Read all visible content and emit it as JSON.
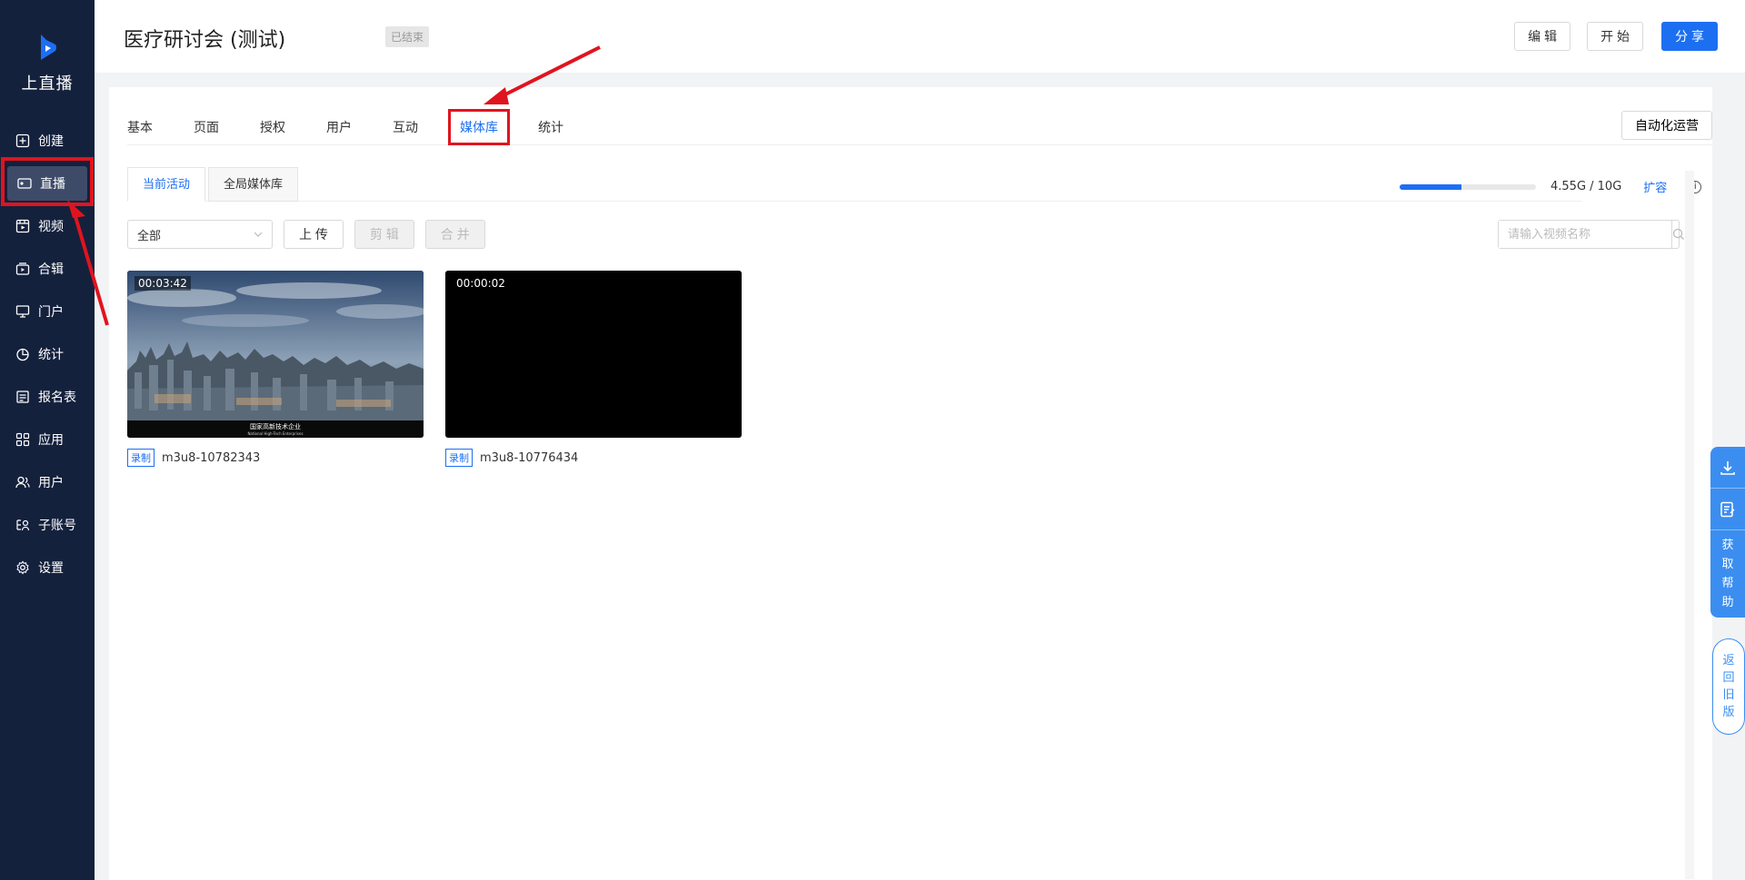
{
  "sidebar": {
    "brand": "上直播",
    "items": [
      {
        "label": "创建",
        "icon": "plus-square-icon"
      },
      {
        "label": "直播",
        "icon": "video-camera-icon"
      },
      {
        "label": "视频",
        "icon": "film-icon"
      },
      {
        "label": "合辑",
        "icon": "collection-icon"
      },
      {
        "label": "门户",
        "icon": "monitor-icon"
      },
      {
        "label": "统计",
        "icon": "pie-chart-icon"
      },
      {
        "label": "报名表",
        "icon": "form-icon"
      },
      {
        "label": "应用",
        "icon": "apps-grid-icon"
      },
      {
        "label": "用户",
        "icon": "users-icon"
      },
      {
        "label": "子账号",
        "icon": "sub-account-icon"
      },
      {
        "label": "设置",
        "icon": "gear-icon"
      }
    ],
    "active_index": 1
  },
  "header": {
    "title": "医疗研讨会 (测试)",
    "status": "已结束",
    "edit_label": "编 辑",
    "start_label": "开 始",
    "share_label": "分 享"
  },
  "tabs": {
    "items": [
      "基本",
      "页面",
      "授权",
      "用户",
      "互动",
      "媒体库",
      "统计"
    ],
    "active": "媒体库",
    "automation_label": "自动化运营"
  },
  "subtabs": {
    "items": [
      "当前活动",
      "全局媒体库"
    ],
    "active": "当前活动"
  },
  "storage": {
    "used_text": "4.55G / 10G",
    "used_fraction": 0.455,
    "expand_label": "扩容",
    "info_icon": "info-circle-icon"
  },
  "toolbar": {
    "filter_value": "全部",
    "upload_label": "上 传",
    "clip_label": "剪 辑",
    "merge_label": "合 并",
    "search_placeholder": "请输入视频名称"
  },
  "media": [
    {
      "duration": "00:03:42",
      "tag": "录制",
      "name": "m3u8-10782343",
      "caption_cn": "国家高新技术企业",
      "caption_en": "National High-Tech Enterprises"
    },
    {
      "duration": "00:00:02",
      "tag": "录制",
      "name": "m3u8-10776434"
    }
  ],
  "float": {
    "help_text": "获取帮助",
    "back_text": "返回旧版"
  },
  "colors": {
    "sidebar_bg": "#14213d",
    "accent": "#1d6ff2",
    "annotation": "#e0141e"
  }
}
